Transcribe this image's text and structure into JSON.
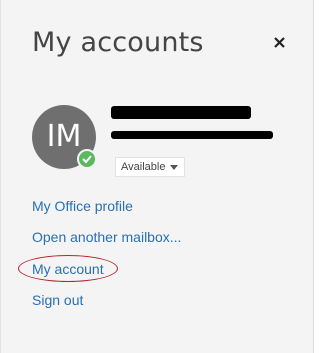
{
  "panel": {
    "title": "My accounts",
    "close_icon": "close-icon"
  },
  "account": {
    "initials": "IM",
    "presence_color": "#5cb85c",
    "status": "Available",
    "status_icon": "chevron-down-icon"
  },
  "menu": {
    "items": [
      {
        "label": "My Office profile"
      },
      {
        "label": "Open another mailbox..."
      },
      {
        "label": "My account"
      },
      {
        "label": "Sign out"
      }
    ]
  },
  "colors": {
    "link": "#2a6fb0",
    "annotation": "#b8232f"
  }
}
